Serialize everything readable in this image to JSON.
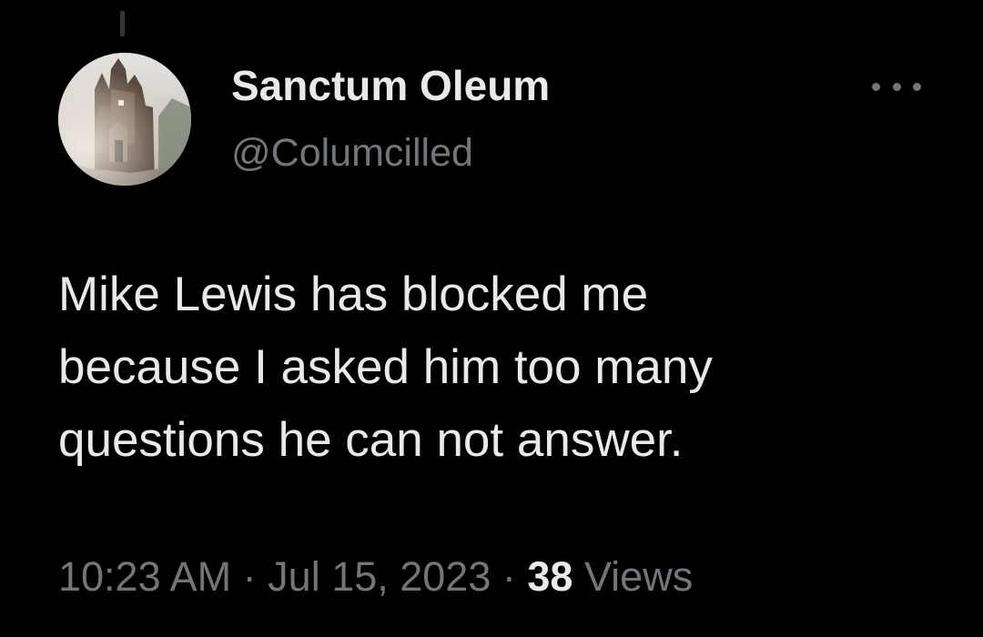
{
  "user": {
    "display_name": "Sanctum Oleum",
    "handle": "@Columcilled",
    "avatar_icon": "castle-avatar-image"
  },
  "actions": {
    "more_icon": "more-horizontal-icon"
  },
  "tweet": {
    "lines": [
      "Mike Lewis has blocked me",
      "because I asked him too many",
      "questions he can not answer."
    ]
  },
  "meta": {
    "time": "10:23 AM",
    "separator": "·",
    "date": "Jul 15, 2023",
    "views_count": "38",
    "views_label": "Views"
  },
  "colors": {
    "background": "#000000",
    "primary_text": "#e7e9ea",
    "secondary_text": "#71767b",
    "thread_line": "#333639"
  }
}
